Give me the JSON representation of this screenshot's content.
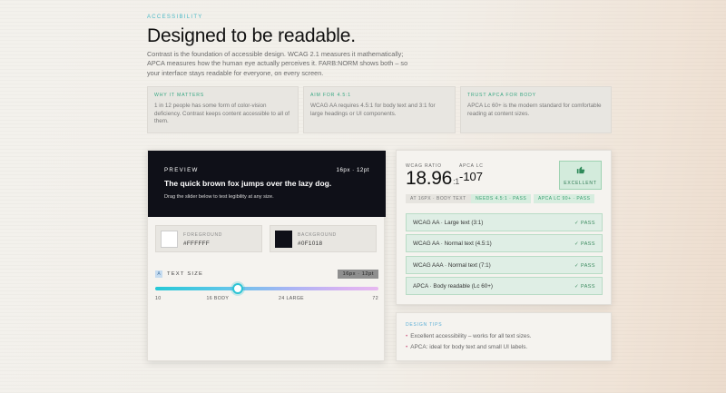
{
  "hero": {
    "eyebrow": "ACCESSIBILITY",
    "headline": "Designed to be readable.",
    "lede": "Contrast is the foundation of accessible design. WCAG 2.1 measures it mathematically; APCA measures how the human eye actually perceives it. FARB:NORM shows both – so your interface stays readable for everyone, on every screen."
  },
  "info_cards": [
    {
      "title": "WHY IT MATTERS",
      "text": "1 in 12 people has some form of color-vision deficiency. Contrast keeps content accessible to all of them."
    },
    {
      "title": "AIM FOR 4.5:1",
      "text": "WCAG AA requires 4.5:1 for body text and 3:1 for large headings or UI components."
    },
    {
      "title": "TRUST APCA FOR BODY",
      "text": "APCA Lc 60+ is the modern standard for comfortable reading at content sizes."
    }
  ],
  "preview": {
    "label": "PREVIEW",
    "meta": "16px · 12pt",
    "sample": "The quick brown fox jumps over the lazy dog.",
    "hint": "Drag the slider below to test legibility at any size."
  },
  "colors": {
    "foreground": {
      "label": "FOREGROUND",
      "value": "#FFFFFF"
    },
    "background": {
      "label": "BACKGROUND",
      "value": "#0F1018"
    }
  },
  "text_size": {
    "label": "TEXT SIZE",
    "value_pill": "16px · 12pt",
    "min": 10,
    "max": 72,
    "current": 16,
    "ticks": [
      {
        "label": "10",
        "value": 10
      },
      {
        "label": "16 BODY",
        "value": 16
      },
      {
        "label": "24 LARGE",
        "value": 24
      },
      {
        "label": "72",
        "value": 72
      }
    ]
  },
  "metrics": {
    "ratio_label": "WCAG RATIO",
    "ratio_value": "18.96",
    "ratio_suffix": ":1",
    "apca_label": "APCA LC",
    "apca_value": "-107",
    "verdict": "EXCELLENT",
    "chips": [
      {
        "text": "AT 16PX · BODY TEXT",
        "style": "gray"
      },
      {
        "text": "NEEDS 4.5:1 · PASS",
        "style": "green"
      },
      {
        "text": "APCA LC 90+ · PASS",
        "style": "green"
      }
    ],
    "checks": [
      {
        "label": "WCAG AA · Large text (3:1)",
        "status": "✓ PASS"
      },
      {
        "label": "WCAG AA · Normal text (4.5:1)",
        "status": "✓ PASS"
      },
      {
        "label": "WCAG AAA · Normal text (7:1)",
        "status": "✓ PASS"
      },
      {
        "label": "APCA · Body readable (Lc 60+)",
        "status": "✓ PASS"
      }
    ]
  },
  "tips": {
    "title": "DESIGN TIPS",
    "items": [
      "Excellent accessibility – works for all text sizes.",
      "APCA: ideal for body text and small UI labels."
    ]
  },
  "palette": {
    "accent_teal": "#4ab8c6",
    "pass_green": "#3a8a5e",
    "thumb_icon": "thumbs-up-icon"
  }
}
